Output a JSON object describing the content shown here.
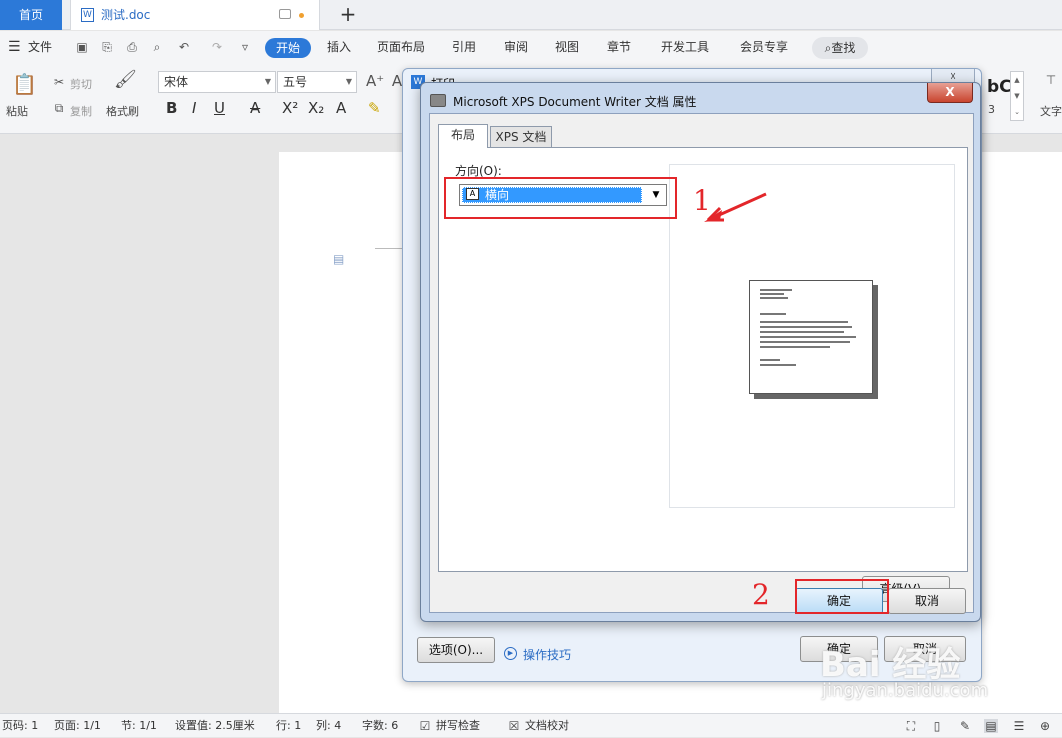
{
  "tabs": {
    "home": "首页",
    "doc": "测试.doc",
    "add": "+"
  },
  "menu": {
    "file": "文件",
    "items": [
      "开始",
      "插入",
      "页面布局",
      "引用",
      "审阅",
      "视图",
      "章节",
      "开发工具",
      "会员专享"
    ],
    "search": "查找"
  },
  "ribbon": {
    "paste": "粘贴",
    "cut": "剪切",
    "copy": "复制",
    "format_painter": "格式刷",
    "font_name": "宋体",
    "font_size": "五号",
    "style_preview": "bC",
    "right_label": "文字",
    "size_num": "3"
  },
  "print_dialog": {
    "title": "打印",
    "close": "☓",
    "options_button": "选项(O)...",
    "tips": "操作技巧",
    "ok": "确定",
    "cancel": "取消"
  },
  "props_dialog": {
    "title": "Microsoft XPS Document Writer 文档 属性",
    "close": "X",
    "tabs": [
      "布局",
      "XPS 文档"
    ],
    "orientation_label": "方向(O):",
    "orientation_value": "横向",
    "advanced": "高级(V)...",
    "ok": "确定",
    "cancel": "取消"
  },
  "annotations": {
    "step1": "1",
    "step2": "2",
    "color": "#e3262a"
  },
  "statusbar": {
    "page_code": "页码: 1",
    "page": "页面: 1/1",
    "section": "节: 1/1",
    "set_value": "设置值: 2.5厘米",
    "row": "行: 1",
    "col": "列: 4",
    "words": "字数: 6",
    "spell": "拼写检查",
    "proof": "文档校对"
  },
  "watermark": {
    "brand": "Bai 经验",
    "url": "jingyan.baidu.com"
  },
  "colors": {
    "accent": "#2c79d8",
    "selection": "#3399ff",
    "annotation": "#e3262a"
  }
}
